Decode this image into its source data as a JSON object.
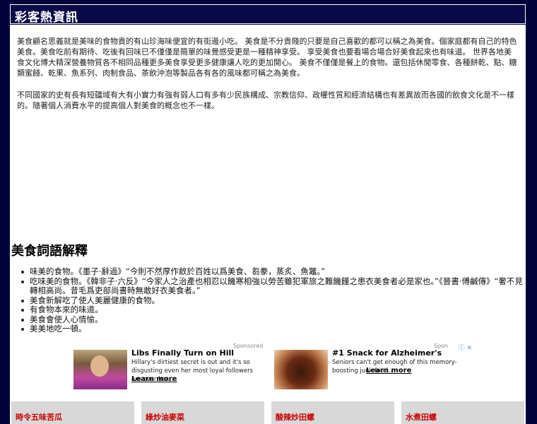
{
  "header": {
    "title": "彩客熱資訊"
  },
  "intro": {
    "paragraph1": "美食顧名思義就是美味的食物貴的有山珍海味便宜的有街邊小吃。 美食是不分貴賤的只要是自己喜歡的都可以稱之為美食。個家庭都有自己的特色美食。美食吃前有期待、吃後有回味已不僅僅是簡單的味覺感受更是一種精神享受。 享受美食也要看場合場合好美食起來也有味道。 世界各地美食文化博大精深營養物質各不相同品種更多美食享受更多健康讓人吃的更加開心。 美食不僅僅是餐上的食物。還包括休閒零食、各種餅乾、點、糖類蜜餞、乾果、魚系列、肉制食品、茶飲沖泡等製品各有各的風味都可稱之為美食。",
    "paragraph2": "不同國家的史有長有短疆域有大有小實力有強有弱人口有多有少民族構成、宗教信仰、政權性質和經濟結構也有差異故而各國的飲食文化是不一樣的。隨著個人消費水平的提高個人對美食的概念也不一樣。"
  },
  "section": {
    "title": "美食詞語解釋",
    "items": [
      "味美的食物。《墨子·辭過》“今則不然厚作斂於百姓以爲美食、芻豢，蒸炙、魚鼈。”",
      "吃味美的食物。《韓非子·六反》“今家人之治產也相忍以饑寒相強以勞苦雖犯軍旅之難饑饉之患衣美食者必是家也。”《晉書·傅鹹傳》“奢不見轉相高尚。昔毛爲吏部尚書時無敢好衣美食者。”",
      "美食新解吃了使人美麗健康的食物。",
      "有食物本來的味道。",
      "美食會使人心情愉。",
      "美美地吃一頓。"
    ]
  },
  "ads": [
    {
      "sponsored": "Sponsored",
      "headline": "Libs Finally Turn on Hill",
      "desc": "Hillary's dirtiest secret is out and it's so disgusting even her most loyal followers are over her...",
      "cta": "Learn more"
    },
    {
      "sponsored": "Spon",
      "headline": "#1 Snack for Alzheimer's",
      "desc": "Seniors can't get enough of this memory-boosting junk food...",
      "cta": "Learn more"
    }
  ],
  "recipes": [
    "時令五味苦瓜",
    "綠炒油麥菜",
    "酸辣炒田螺",
    "水煮田螺"
  ],
  "colors": {
    "background": "#00003a",
    "header": "#0a0a48",
    "recipe_text": "#cc0000"
  }
}
